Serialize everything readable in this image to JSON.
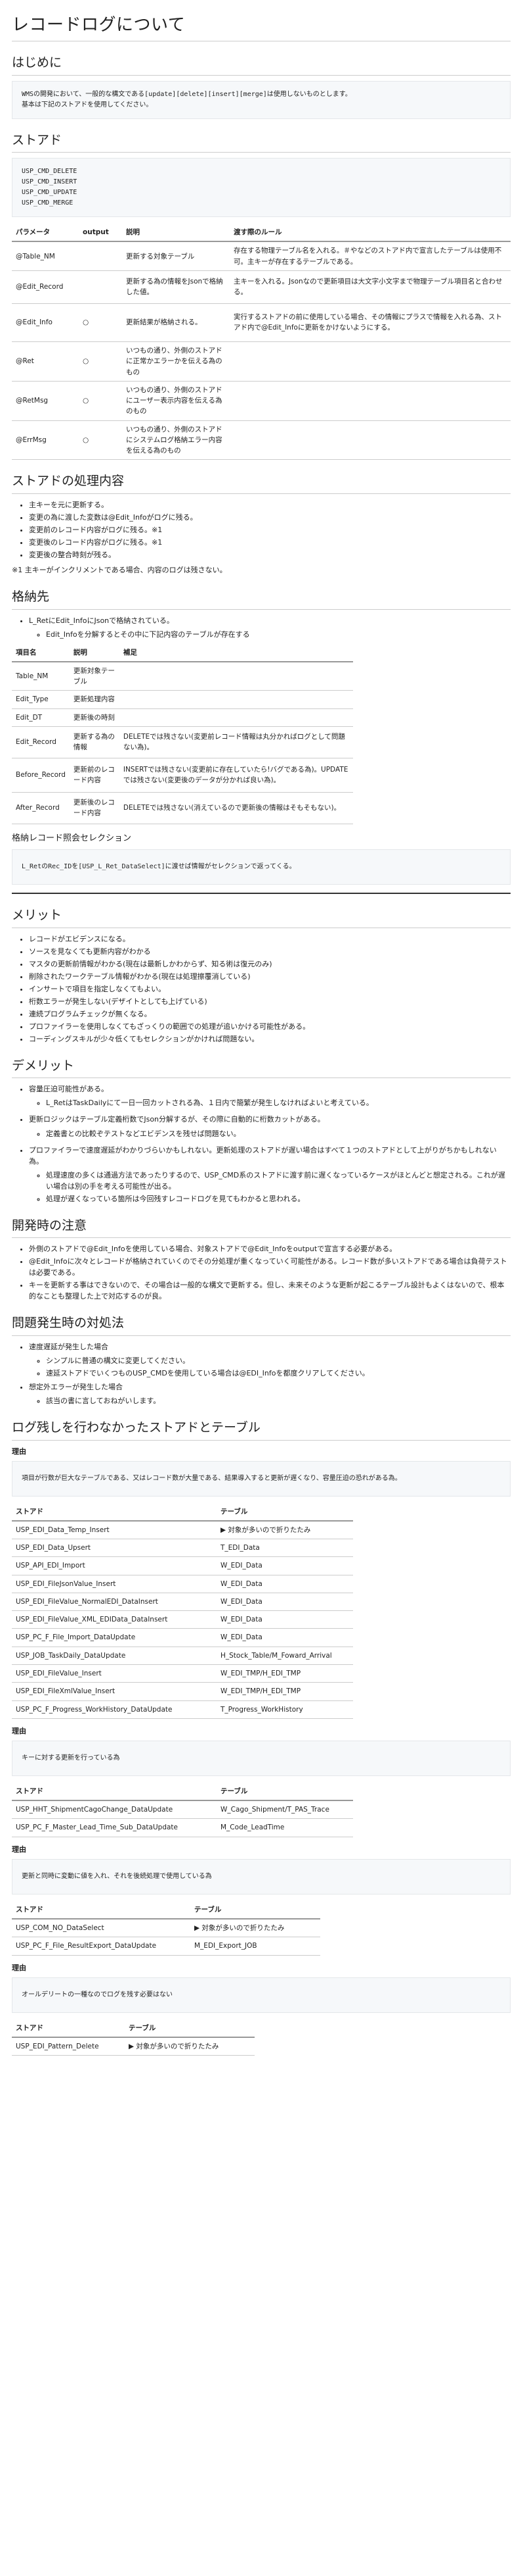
{
  "title": "レコードログについて",
  "intro": {
    "heading": "はじめに",
    "l1": "WMSの開発において、一般的な構文である[update][delete][insert][merge]は使用しないものとします。",
    "l2": "基本は下記のストアドを使用してください。"
  },
  "stored": {
    "heading": "ストアド",
    "items": [
      "USP_CMD_DELETE",
      "USP_CMD_INSERT",
      "USP_CMD_UPDATE",
      "USP_CMD_MERGE"
    ]
  },
  "params": {
    "headers": [
      "パラメータ",
      "output",
      "説明",
      "渡す際のルール"
    ],
    "rows": [
      [
        "@Table_NM",
        "",
        "更新する対象テーブル",
        "存在する物理テーブル名を入れる。＃やなどのストアド内で宣言したテーブルは使用不可。主キーが存在するテーブルである。"
      ],
      [
        "@Edit_Record",
        "",
        "更新する為の情報をJsonで格納した値。",
        "主キーを入れる。Jsonなので更新項目は大文字小文字まで物理テーブル項目名と合わせる。"
      ],
      [
        "@Edit_Info",
        "○",
        "更新結果が格納される。",
        "実行するストアドの前に使用している場合、その情報にプラスで情報を入れる為、ストアド内で@Edit_Infoに更新をかけないようにする。"
      ],
      [
        "@Ret",
        "○",
        "いつもの通り、外側のストアドに正常かエラーかを伝える為のもの",
        ""
      ],
      [
        "@RetMsg",
        "○",
        "いつもの通り、外側のストアドにユーザー表示内容を伝える為のもの",
        ""
      ],
      [
        "@ErrMsg",
        "○",
        "いつもの通り、外側のストアドにシステムログ格納エラー内容を伝える為のもの",
        ""
      ]
    ]
  },
  "process": {
    "heading": "ストアドの処理内容",
    "items": [
      "主キーを元に更新する。",
      "変更の為に渡した変数は@Edit_Infoがログに残る。",
      "変更前のレコード内容がログに残る。※1",
      "変更後のレコード内容がログに残る。※1",
      "変更後の整合時刻が残る。"
    ],
    "note": "※1 主キーがインクリメントである場合、内容のログは残さない。"
  },
  "storage": {
    "heading": "格納先",
    "items": [
      "L_RetにEdit_InfoにJsonで格納されている。"
    ],
    "sub": [
      "Edit_Infoを分解するとその中に下記内容のテーブルが存在する"
    ]
  },
  "items_table": {
    "headers": [
      "項目名",
      "説明",
      "補足"
    ],
    "rows": [
      [
        "Table_NM",
        "更新対象テーブル",
        ""
      ],
      [
        "Edit_Type",
        "更新処理内容",
        ""
      ],
      [
        "Edit_DT",
        "更新後の時刻",
        ""
      ],
      [
        "Edit_Record",
        "更新する為の情報",
        "DELETEでは残さない(変更前レコード情報は丸分かればログとして問題ない為)。"
      ],
      [
        "Before_Record",
        "更新前のレコード内容",
        "INSERTでは残さない(変更前に存在していたら!バグである為)。UPDATEでは残さない(変更後のデータが分かれば良い為)。"
      ],
      [
        "After_Record",
        "更新後のレコード内容",
        "DELETEでは残さない(消えているので更新後の情報はそもそもない)。"
      ]
    ]
  },
  "selection": {
    "heading": "格納レコード照会セレクション",
    "code": "L_RetのRec_IDを[USP_L_Ret_DataSelect]に渡せば情報がセレクションで返ってくる。"
  },
  "merit": {
    "heading": "メリット",
    "items": [
      "レコードがエビデンスになる。",
      "ソースを見なくても更新内容がわかる",
      "マスタの更新前情報がわかる(現在は最新しかわからず、知る術は復元のみ)",
      "削除されたワークテーブル情報がわかる(現在は処理擦覆消している)",
      "インサートで項目を指定しなくてもよい。",
      "桁数エラーが発生しない(デザイトとしても上げている)",
      "連続プログラムチェックが無くなる。",
      "プロファイラーを使用しなくてもざっくりの範囲での処理が追いかける可能性がある。",
      "コーディングスキルが少々低くてもセレクションがかければ問題ない。"
    ]
  },
  "demerit": {
    "heading": "デメリット",
    "items": [
      {
        "text": "容量圧迫可能性がある。",
        "sub": [
          "L_RetはTaskDailyにて一日一回カットされる為、１日内で簡繁が発生しなければよいと考えている。"
        ]
      },
      {
        "text": "更新ロジックはテーブル定義桁数でJson分解するが、その際に自動的に桁数カットがある。",
        "sub": [
          "定義書との比較ぞテストなどエビデンスを残せば問題ない。"
        ]
      },
      {
        "text": "プロファイラーで速度遅延がわかりづらいかもしれない。更新処理のストアドが遅い場合はすべて１つのストアドとして上がりがちかもしれない為。",
        "sub": [
          "処理速度の多くは通過方法であったりするので、USP_CMD系のストアドに渡す前に遅くなっているケースがほとんどと想定される。これが遅い場合は別の手を考える可能性が出る。",
          "処理が遅くなっている箇所は今回残すレコードログを見てもわかると思われる。"
        ]
      }
    ]
  },
  "caution": {
    "heading": "開発時の注意",
    "items": [
      "外側のストアドで@Edit_Infoを使用している場合、対象ストアドで@Edit_Infoをoutputで宣言する必要がある。",
      "@Edit_Infoに次々とレコードが格納されていくのでその分処理が重くなっていく可能性がある。レコード数が多いストアドである場合は負荷テストは必要である。",
      "キーを更新する事はできないので、その場合は一般的な構文で更新する。但し、未来そのような更新が起こるテーブル設計もよくはないので、根本的なことも整理した上で対応するのが良。"
    ]
  },
  "trouble": {
    "heading": "問題発生時の対処法",
    "items": [
      {
        "text": "速度遅延が発生した場合",
        "sub": [
          "シンプルに普通の構文に変更してください。",
          "速延ストアドでいくつものUSP_CMDを使用している場合は@EDI_Infoを都度クリアしてください。"
        ]
      },
      {
        "text": "想定外エラーが発生した場合",
        "sub": [
          "該当の書に言しておねがいします。"
        ]
      }
    ]
  },
  "nolog": {
    "heading": "ログ残しを行わなかったストアドとテーブル",
    "reason_label": "理由",
    "headers": [
      "ストアド",
      "テーブル"
    ],
    "groups": [
      {
        "reason": "項目が行数が巨大なテーブルである、又はレコード数が大量である、結果導入すると更新が遅くなり、容量圧迫の恐れがある為。",
        "rows": [
          [
            "USP_EDI_Data_Temp_Insert",
            "▶ 対象が多いので折りたたみ"
          ],
          [
            "USP_EDI_Data_Upsert",
            "T_EDI_Data"
          ],
          [
            "USP_API_EDI_Import",
            "W_EDI_Data"
          ],
          [
            "USP_EDI_FileJsonValue_Insert",
            "W_EDI_Data"
          ],
          [
            "USP_EDI_FileValue_NormalEDI_DataInsert",
            "W_EDI_Data"
          ],
          [
            "USP_EDI_FileValue_XML_EDIData_DataInsert",
            "W_EDI_Data"
          ],
          [
            "USP_PC_F_File_Import_DataUpdate",
            "W_EDI_Data"
          ],
          [
            "USP_JOB_TaskDaily_DataUpdate",
            "H_Stock_Table/M_Foward_Arrival"
          ],
          [
            "USP_EDI_FileValue_Insert",
            "W_EDI_TMP/H_EDI_TMP"
          ],
          [
            "USP_EDI_FileXmlValue_Insert",
            "W_EDI_TMP/H_EDI_TMP"
          ],
          [
            "USP_PC_F_Progress_WorkHistory_DataUpdate",
            "T_Progress_WorkHistory"
          ]
        ]
      },
      {
        "reason": "キーに対する更新を行っている為",
        "rows": [
          [
            "USP_HHT_ShipmentCagoChange_DataUpdate",
            "W_Cago_Shipment/T_PAS_Trace"
          ],
          [
            "USP_PC_F_Master_Lead_Time_Sub_DataUpdate",
            "M_Code_LeadTime"
          ]
        ]
      },
      {
        "reason": "更新と同時に変動に値を入れ、それを後続処理で使用している為",
        "rows": [
          [
            "USP_COM_NO_DataSelect",
            "▶ 対象が多いので折りたたみ"
          ],
          [
            "USP_PC_F_File_ResultExport_DataUpdate",
            "M_EDI_Export_JOB"
          ]
        ]
      },
      {
        "reason": "オールデリートの一種なのでログを残す必要はない",
        "rows": [
          [
            "USP_EDI_Pattern_Delete",
            "▶ 対象が多いので折りたたみ"
          ]
        ]
      }
    ]
  }
}
